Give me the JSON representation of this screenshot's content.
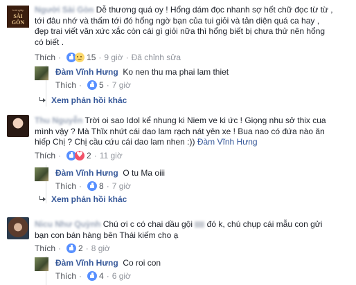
{
  "comments": [
    {
      "avatar_text_top": "tướngiấy",
      "avatar_text": "SÀI GÒN",
      "author_hidden": "Người Sài Gòn",
      "lines": [
        "Dễ thương quá oy ! Hổng dám đọc nhanh sợ hết chữ đọc từ từ ,",
        "tới đâu nhớ và thấm tới đó hổng ngờ bạn của tui giỏi và tản diện quá ca hay ,",
        "đẹp trai viết văn xức xắc còn cái gì giỏi nữa thì hổng biết bị chưa thử nên hổng",
        "có biết ."
      ],
      "actions": {
        "like": "Thích",
        "count": "15",
        "time": "9 giờ",
        "edited": "Đã chỉnh sửa"
      },
      "reply": {
        "author": "Đàm Vĩnh Hưng",
        "text": "Ko nen thu ma phai lam thiet",
        "like": "Thích",
        "count": "5",
        "time": "7 giờ"
      },
      "more_replies": "Xem phản hồi khác"
    },
    {
      "author_hidden": "Thu Nguyễn",
      "lines": [
        "Trời oi sao Idol kể nhung ki Niem ve ki ức ! Giọng nhu sở thix cua",
        "mình vậy ? Mà Thĩx nhứt cái dao lam rạch nát yên xe ! Bua nao có đứa nào ăn",
        "hiếp Chị ? Chị cầu cứu cái dao lam nhen :))"
      ],
      "tag": "Đàm Vĩnh Hưng",
      "actions": {
        "like": "Thích",
        "count": "2",
        "time": "11 giờ"
      },
      "reply": {
        "author": "Đàm Vĩnh Hưng",
        "text": "O tu Ma oiii",
        "like": "Thích",
        "count": "8",
        "time": "7 giờ"
      },
      "more_replies": "Xem phản hồi khác"
    },
    {
      "author_hidden": "Nicu Như Quỳnh",
      "lines": [
        "Chú ơi c có chai dầu gội",
        "đó k, chú chụp cái mẫu con gửi",
        "bạn con bán hàng bên Thái kiếm cho ạ"
      ],
      "actions": {
        "like": "Thích",
        "count": "2",
        "time": "8 giờ"
      },
      "reply": {
        "author": "Đàm Vĩnh Hưng",
        "text": "Co roi con",
        "like": "Thích",
        "count": "4",
        "time": "6 giờ"
      }
    }
  ],
  "colors": {
    "link": "#365899",
    "meta": "#90949c",
    "text": "#1d2129",
    "like_blue": "#5890ff",
    "heart_red": "#f25268"
  }
}
